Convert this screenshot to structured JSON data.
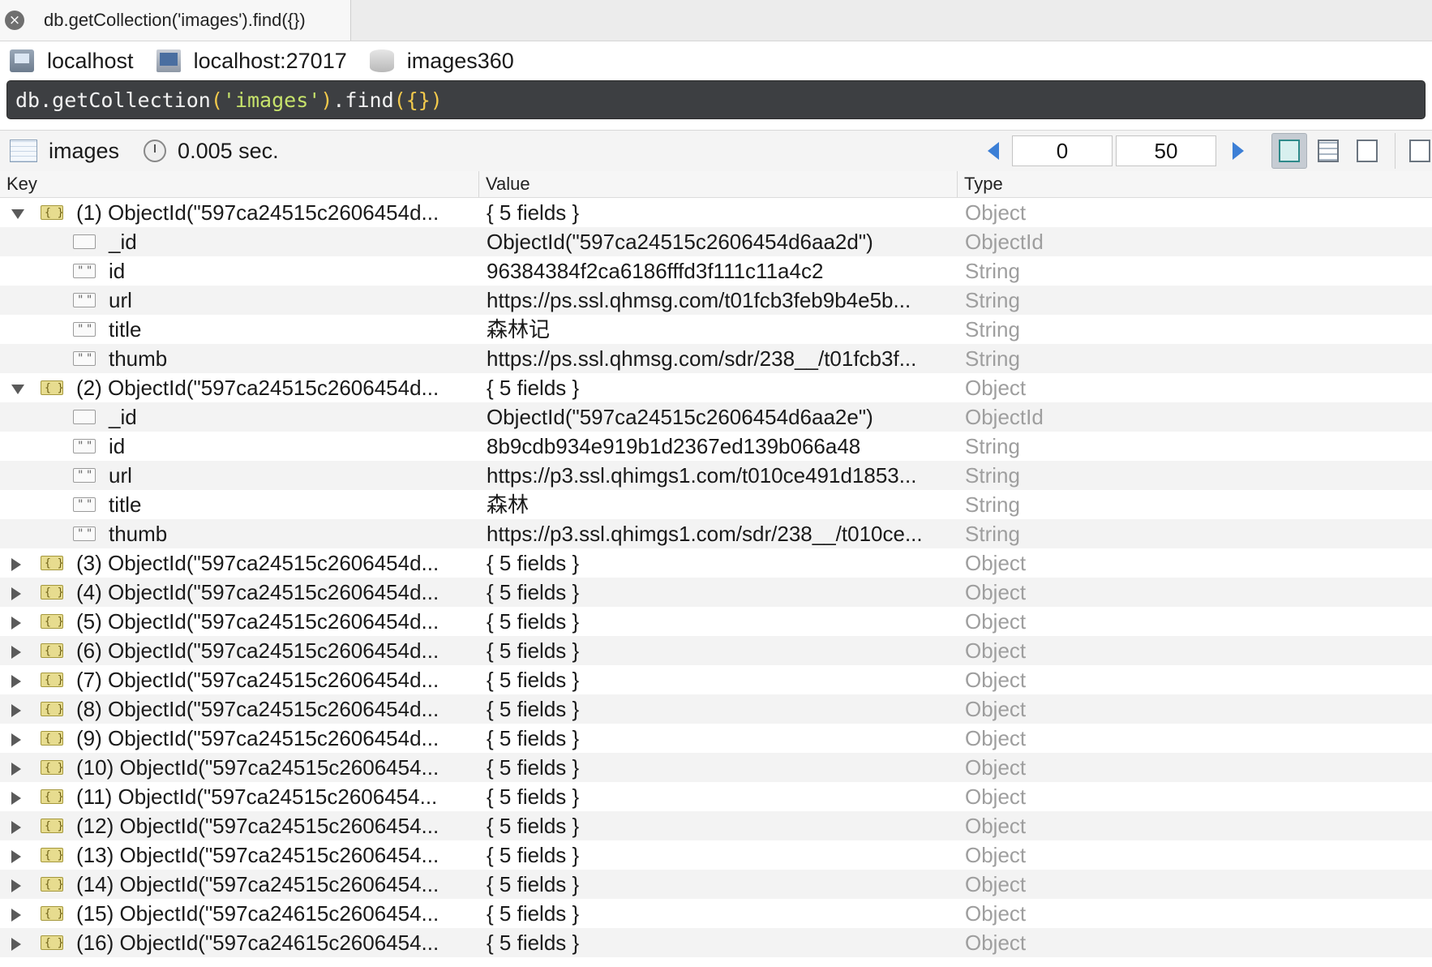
{
  "tab": {
    "title": "db.getCollection('images').find({})",
    "close_glyph": "×"
  },
  "connection": {
    "host": "localhost",
    "server": "localhost:27017",
    "database": "images360"
  },
  "query": {
    "parts": [
      {
        "text": "db",
        "kind": "plain"
      },
      {
        "text": ".getCollection",
        "kind": "plain"
      },
      {
        "text": "(",
        "kind": "paren"
      },
      {
        "text": "'images'",
        "kind": "str"
      },
      {
        "text": ")",
        "kind": "paren"
      },
      {
        "text": ".find",
        "kind": "plain"
      },
      {
        "text": "({})",
        "kind": "paren"
      }
    ]
  },
  "results": {
    "collection": "images",
    "time": "0.005 sec.",
    "skip": "0",
    "limit": "50"
  },
  "columns": {
    "key": "Key",
    "value": "Value",
    "type": "Type"
  },
  "rows": [
    {
      "kind": "doc",
      "expanded": true,
      "key": "(1) ObjectId(\"597ca24515c2606454d...",
      "value": "{ 5 fields }",
      "type": "Object"
    },
    {
      "kind": "field",
      "ftype": "oid",
      "key": "_id",
      "value": "ObjectId(\"597ca24515c2606454d6aa2d\")",
      "type": "ObjectId"
    },
    {
      "kind": "field",
      "ftype": "str",
      "key": "id",
      "value": "96384384f2ca6186fffd3f111c11a4c2",
      "type": "String"
    },
    {
      "kind": "field",
      "ftype": "str",
      "key": "url",
      "value": "https://ps.ssl.qhmsg.com/t01fcb3feb9b4e5b...",
      "type": "String"
    },
    {
      "kind": "field",
      "ftype": "str",
      "key": "title",
      "value": "森林记",
      "type": "String"
    },
    {
      "kind": "field",
      "ftype": "str",
      "key": "thumb",
      "value": "https://ps.ssl.qhmsg.com/sdr/238__/t01fcb3f...",
      "type": "String"
    },
    {
      "kind": "doc",
      "expanded": true,
      "key": "(2) ObjectId(\"597ca24515c2606454d...",
      "value": "{ 5 fields }",
      "type": "Object"
    },
    {
      "kind": "field",
      "ftype": "oid",
      "key": "_id",
      "value": "ObjectId(\"597ca24515c2606454d6aa2e\")",
      "type": "ObjectId"
    },
    {
      "kind": "field",
      "ftype": "str",
      "key": "id",
      "value": "8b9cdb934e919b1d2367ed139b066a48",
      "type": "String"
    },
    {
      "kind": "field",
      "ftype": "str",
      "key": "url",
      "value": "https://p3.ssl.qhimgs1.com/t010ce491d1853...",
      "type": "String"
    },
    {
      "kind": "field",
      "ftype": "str",
      "key": "title",
      "value": "森林",
      "type": "String"
    },
    {
      "kind": "field",
      "ftype": "str",
      "key": "thumb",
      "value": "https://p3.ssl.qhimgs1.com/sdr/238__/t010ce...",
      "type": "String"
    },
    {
      "kind": "doc",
      "expanded": false,
      "key": "(3) ObjectId(\"597ca24515c2606454d...",
      "value": "{ 5 fields }",
      "type": "Object"
    },
    {
      "kind": "doc",
      "expanded": false,
      "key": "(4) ObjectId(\"597ca24515c2606454d...",
      "value": "{ 5 fields }",
      "type": "Object"
    },
    {
      "kind": "doc",
      "expanded": false,
      "key": "(5) ObjectId(\"597ca24515c2606454d...",
      "value": "{ 5 fields }",
      "type": "Object"
    },
    {
      "kind": "doc",
      "expanded": false,
      "key": "(6) ObjectId(\"597ca24515c2606454d...",
      "value": "{ 5 fields }",
      "type": "Object"
    },
    {
      "kind": "doc",
      "expanded": false,
      "key": "(7) ObjectId(\"597ca24515c2606454d...",
      "value": "{ 5 fields }",
      "type": "Object"
    },
    {
      "kind": "doc",
      "expanded": false,
      "key": "(8) ObjectId(\"597ca24515c2606454d...",
      "value": "{ 5 fields }",
      "type": "Object"
    },
    {
      "kind": "doc",
      "expanded": false,
      "key": "(9) ObjectId(\"597ca24515c2606454d...",
      "value": "{ 5 fields }",
      "type": "Object"
    },
    {
      "kind": "doc",
      "expanded": false,
      "key": "(10) ObjectId(\"597ca24515c2606454...",
      "value": "{ 5 fields }",
      "type": "Object"
    },
    {
      "kind": "doc",
      "expanded": false,
      "key": "(11) ObjectId(\"597ca24515c2606454...",
      "value": "{ 5 fields }",
      "type": "Object"
    },
    {
      "kind": "doc",
      "expanded": false,
      "key": "(12) ObjectId(\"597ca24515c2606454...",
      "value": "{ 5 fields }",
      "type": "Object"
    },
    {
      "kind": "doc",
      "expanded": false,
      "key": "(13) ObjectId(\"597ca24515c2606454...",
      "value": "{ 5 fields }",
      "type": "Object"
    },
    {
      "kind": "doc",
      "expanded": false,
      "key": "(14) ObjectId(\"597ca24515c2606454...",
      "value": "{ 5 fields }",
      "type": "Object"
    },
    {
      "kind": "doc",
      "expanded": false,
      "key": "(15) ObjectId(\"597ca24615c2606454...",
      "value": "{ 5 fields }",
      "type": "Object"
    },
    {
      "kind": "doc",
      "expanded": false,
      "key": "(16) ObjectId(\"597ca24615c2606454...",
      "value": "{ 5 fields }",
      "type": "Object"
    }
  ]
}
